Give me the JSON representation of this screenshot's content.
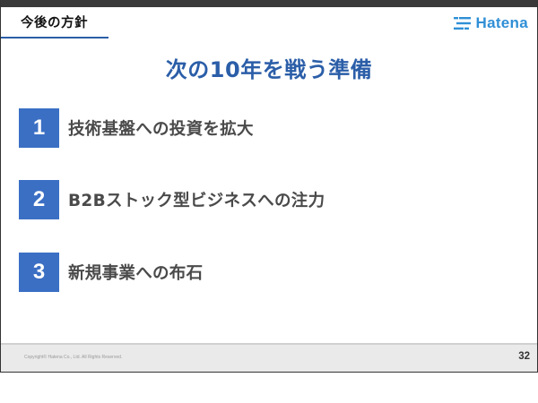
{
  "header": {
    "section_title": "今後の方針",
    "logo_text": "Hatena",
    "logo_icon": "hatena-logo-mark"
  },
  "headline": "次の10年を戦う準備",
  "items": [
    {
      "number": "1",
      "text": "技術基盤への投資を拡大"
    },
    {
      "number": "2",
      "text": "B2Bストック型ビジネスへの注力"
    },
    {
      "number": "3",
      "text": "新規事業への布石"
    }
  ],
  "footer": {
    "copyright": "Copyright© Hatena Co., Ltd. All Rights Reserved.",
    "page_number": "32"
  },
  "colors": {
    "accent_blue": "#2b5ea8",
    "number_box": "#3b6fc4",
    "logo_blue": "#2f8fd6",
    "item_text": "#4a4a4a"
  }
}
